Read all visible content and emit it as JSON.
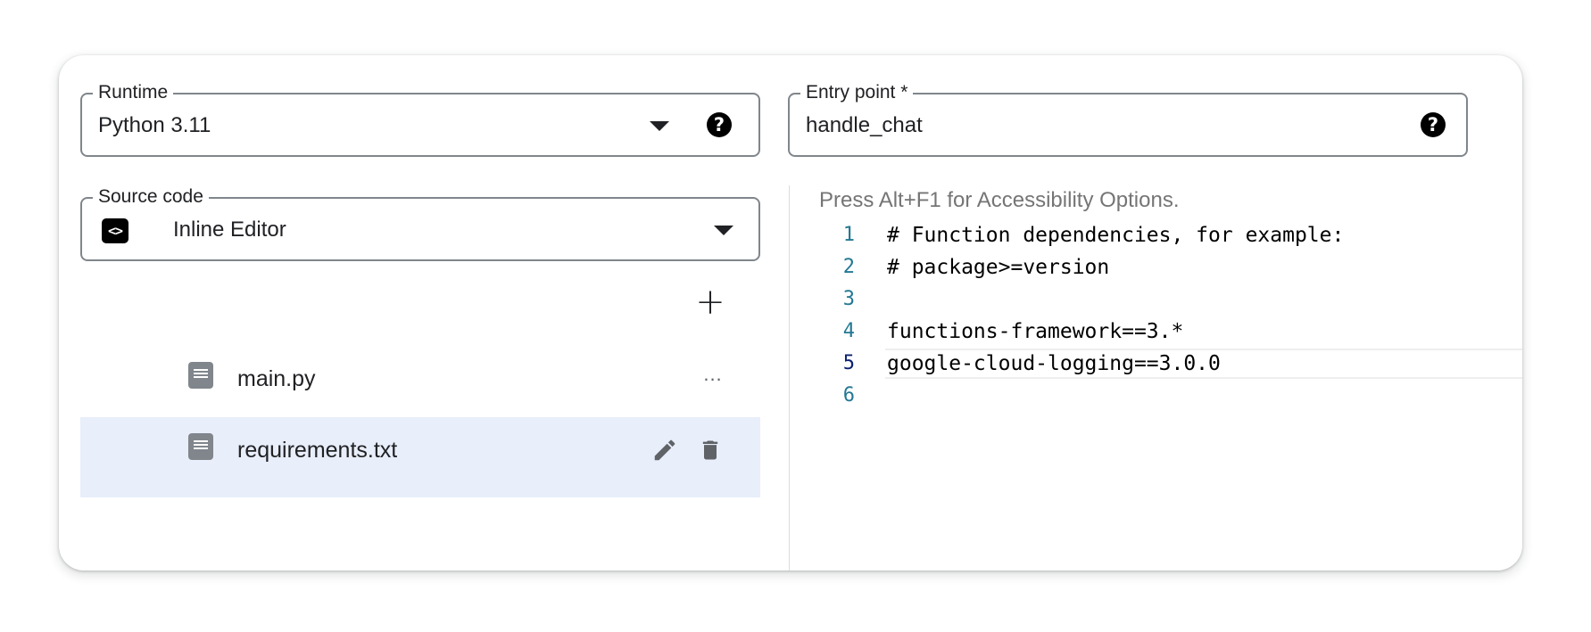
{
  "runtime": {
    "label": "Runtime",
    "value": "Python 3.11"
  },
  "entry_point": {
    "label": "Entry point *",
    "value": "handle_chat"
  },
  "source_code": {
    "label": "Source code",
    "value": "Inline Editor",
    "icon": "code-icon"
  },
  "files": {
    "add_icon": "+",
    "more_icon": "...",
    "items": [
      {
        "name": "main.py",
        "selected": false
      },
      {
        "name": "requirements.txt",
        "selected": true
      }
    ]
  },
  "editor": {
    "accessibility_hint": "Press Alt+F1 for Accessibility Options.",
    "lines": [
      {
        "num": "1",
        "text": "# Function dependencies, for example:"
      },
      {
        "num": "2",
        "text": "# package>=version"
      },
      {
        "num": "3",
        "text": ""
      },
      {
        "num": "4",
        "text": "functions-framework==3.*"
      },
      {
        "num": "5",
        "text": "google-cloud-logging==3.0.0"
      },
      {
        "num": "6",
        "text": ""
      }
    ]
  },
  "colors": {
    "selected_row": "#e8eefa",
    "line_number": "#237893",
    "accent_dark": "#0b216f"
  }
}
